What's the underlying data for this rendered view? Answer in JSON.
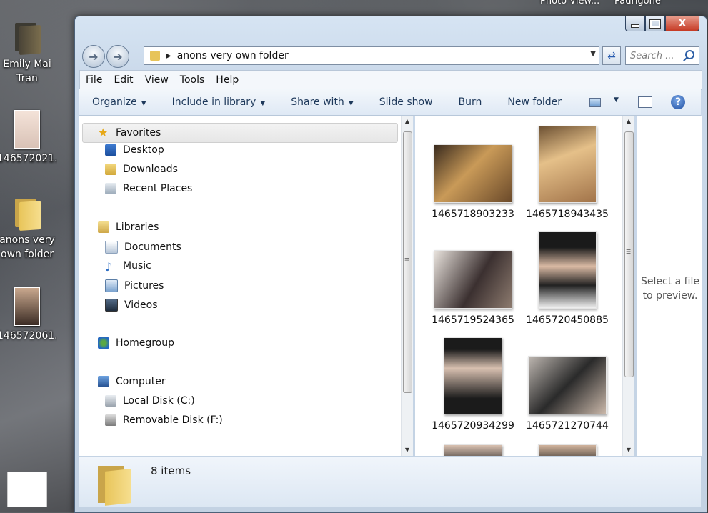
{
  "desktop": {
    "top_peek": [
      "Photo View...",
      "Padrigone"
    ],
    "icons": [
      {
        "label_lines": [
          "Emily Mai",
          "Tran"
        ],
        "type": "folder-dark"
      },
      {
        "label_lines": [
          "146572021..."
        ],
        "type": "photo"
      },
      {
        "label_lines": [
          "anons very",
          "own folder"
        ],
        "type": "folder"
      },
      {
        "label_lines": [
          "146572061..."
        ],
        "type": "photo"
      }
    ]
  },
  "window": {
    "buttons": {
      "minimize": "",
      "maximize": "",
      "close": "X"
    },
    "address": {
      "path": "anons very own folder"
    },
    "search": {
      "placeholder": "Search ..."
    },
    "menu": [
      "File",
      "Edit",
      "View",
      "Tools",
      "Help"
    ],
    "commands": [
      {
        "label": "Organize",
        "dropdown": true
      },
      {
        "label": "Include in library",
        "dropdown": true
      },
      {
        "label": "Share with",
        "dropdown": true
      },
      {
        "label": "Slide show",
        "dropdown": false
      },
      {
        "label": "Burn",
        "dropdown": false
      },
      {
        "label": "New folder",
        "dropdown": false
      }
    ],
    "nav_tree": {
      "favorites": {
        "label": "Favorites",
        "items": [
          "Desktop",
          "Downloads",
          "Recent Places"
        ]
      },
      "libraries": {
        "label": "Libraries",
        "items": [
          "Documents",
          "Music",
          "Pictures",
          "Videos"
        ]
      },
      "homegroup": {
        "label": "Homegroup"
      },
      "computer": {
        "label": "Computer",
        "items": [
          "Local Disk (C:)",
          "Removable Disk (F:)"
        ]
      }
    },
    "files": [
      {
        "name": "1465718903233",
        "thumb_colors": [
          "#6b4a2a",
          "#c89a55"
        ]
      },
      {
        "name": "1465718943435",
        "thumb_colors": [
          "#a2744a",
          "#e5c089"
        ]
      },
      {
        "name": "1465719524365",
        "thumb_colors": [
          "#3b3030",
          "#e8e2dc"
        ]
      },
      {
        "name": "1465720450885",
        "thumb_colors": [
          "#1a1a1a",
          "#d9b9a3"
        ]
      },
      {
        "name": "1465720934299",
        "thumb_colors": [
          "#1b1b1b",
          "#d8c0b0"
        ]
      },
      {
        "name": "1465721270744",
        "thumb_colors": [
          "#2a2a2a",
          "#bdb6b0"
        ]
      }
    ],
    "preview_message": "Select a file to preview.",
    "details": {
      "count": "8 items"
    }
  }
}
